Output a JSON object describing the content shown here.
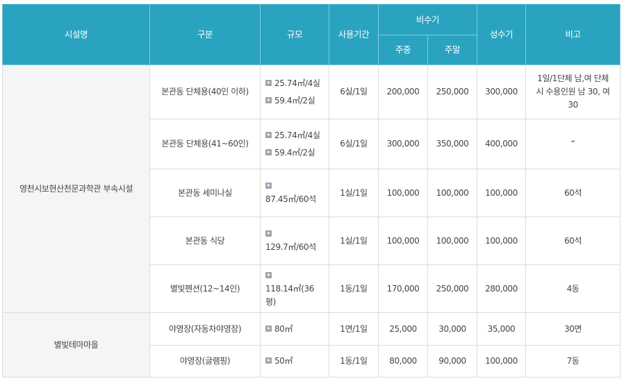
{
  "header": {
    "facility": "시설명",
    "type": "구분",
    "scale": "규모",
    "period": "사용기간",
    "off_peak": "비수기",
    "weekday": "주중",
    "weekend": "주말",
    "peak": "성수기",
    "note": "비고"
  },
  "groups": [
    {
      "facility": "영천시보현산천문과학관 부속시설",
      "rows": [
        {
          "type": "본관동 단체용(40인 이하)",
          "scale": [
            "25.74㎡/4실",
            "59.4㎡/2실"
          ],
          "period": "6실/1일",
          "weekday": "200,000",
          "weekend": "250,000",
          "peak": "300,000",
          "note": "1일/1단체 남,여 단체시 수용인원 남 30, 여 30"
        },
        {
          "type": "본관동 단체용(41~60인)",
          "scale": [
            "25.74㎡/4실",
            "59.4㎡/2실"
          ],
          "period": "6실/1일",
          "weekday": "300,000",
          "weekend": "350,000",
          "peak": "400,000",
          "note": "“"
        },
        {
          "type": "본관동 세미나실",
          "scale": [
            "87.45㎡/60석"
          ],
          "period": "1실/1일",
          "weekday": "100,000",
          "weekend": "100,000",
          "peak": "100,000",
          "note": "60석"
        },
        {
          "type": "본관동 식당",
          "scale": [
            "129.7㎡/60석"
          ],
          "period": "1실/1일",
          "weekday": "100,000",
          "weekend": "100,000",
          "peak": "100,000",
          "note": "60석"
        },
        {
          "type": "별빛펜션(12~14인)",
          "scale": [
            "118.14㎡(36평)"
          ],
          "period": "1동/1일",
          "weekday": "170,000",
          "weekend": "250,000",
          "peak": "280,000",
          "note": "4동"
        }
      ]
    },
    {
      "facility": "별빛테마마을",
      "rows": [
        {
          "type": "야영장(자동차야영장)",
          "scale": [
            "80㎡"
          ],
          "period": "1면/1일",
          "weekday": "25,000",
          "weekend": "30,000",
          "peak": "35,000",
          "note": "30면"
        },
        {
          "type": "야영장(글램핑)",
          "scale": [
            "50㎡"
          ],
          "period": "1동/1일",
          "weekday": "80,000",
          "weekend": "90,000",
          "peak": "100,000",
          "note": "7동"
        }
      ]
    }
  ]
}
